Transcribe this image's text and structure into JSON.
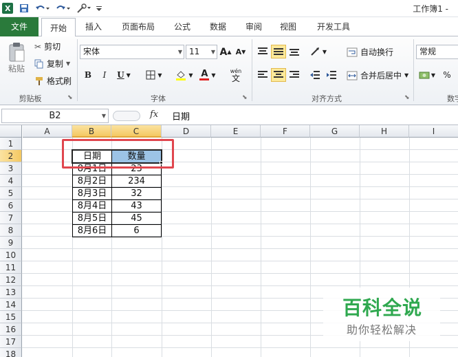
{
  "title_bar": {
    "workbook_title": "工作簿1 -",
    "icons": [
      "excel-icon",
      "save-icon",
      "undo-icon",
      "redo-icon",
      "tools-icon",
      "customize-icon"
    ]
  },
  "ribbon_tabs": [
    "文件",
    "开始",
    "插入",
    "页面布局",
    "公式",
    "数据",
    "审阅",
    "视图",
    "开发工具"
  ],
  "active_tab": "开始",
  "clipboard": {
    "paste": "粘贴",
    "cut": "剪切",
    "copy": "复制",
    "format_painter": "格式刷",
    "group_label": "剪贴板"
  },
  "font": {
    "name": "宋体",
    "size": "11",
    "bold": "B",
    "italic": "I",
    "underline": "U",
    "grow": "A",
    "shrink": "A",
    "font_color": "A",
    "phonetic": "wén",
    "phonetic_char": "文",
    "group_label": "字体"
  },
  "alignment": {
    "wrap_text": "自动换行",
    "merge_center": "合并后居中",
    "group_label": "对齐方式"
  },
  "number": {
    "format": "常规",
    "percent": "%",
    "group_label": "数字"
  },
  "formula_bar": {
    "name_box": "B2",
    "fx": "fx",
    "value": "日期"
  },
  "columns": [
    "A",
    "B",
    "C",
    "D",
    "E",
    "F",
    "G",
    "H",
    "I"
  ],
  "rows": [
    "1",
    "2",
    "3",
    "4",
    "5",
    "6",
    "7",
    "8",
    "9",
    "10",
    "11",
    "12",
    "13",
    "14",
    "15",
    "16",
    "17",
    "18"
  ],
  "table": {
    "headers": [
      "日期",
      "数量"
    ],
    "rows": [
      [
        "8月1日",
        "23"
      ],
      [
        "8月2日",
        "234"
      ],
      [
        "8月3日",
        "32"
      ],
      [
        "8月4日",
        "43"
      ],
      [
        "8月5日",
        "45"
      ],
      [
        "8月6日",
        "6"
      ]
    ]
  },
  "watermark": {
    "main": "百科全说",
    "sub": "助你轻松解决"
  },
  "colors": {
    "file_tab": "#2a7a3b",
    "highlight": "#f4c862",
    "selection_fill": "#9cc3e6",
    "annotation_box": "#e0464e",
    "watermark": "#2fa84f"
  }
}
